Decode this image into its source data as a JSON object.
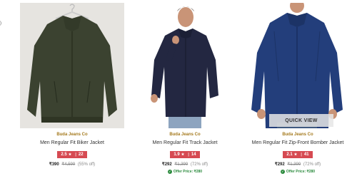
{
  "page": {
    "edge_glyph": ")"
  },
  "products": [
    {
      "brand": "Buda Jeans Co",
      "title": "Men Regular Fit Biker Jacket",
      "rating": "2.5",
      "reviews": "22",
      "price": "₹390",
      "mrp": "₹4,599",
      "discount": "(55% off)",
      "offer": "",
      "jacket_color": "#3b4230",
      "quick_view": ""
    },
    {
      "brand": "Buda Jeans Co",
      "title": "Men Regular Fit Track Jacket",
      "rating": "1.9",
      "reviews": "14",
      "price": "₹292",
      "mrp": "₹1,399",
      "discount": "(72% off)",
      "offer": "Offer Price: ₹280",
      "jacket_color": "#232741",
      "quick_view": ""
    },
    {
      "brand": "Buda Jeans Co",
      "title": "Men Regular Fit Zip-Front Bomber Jacket",
      "rating": "2.1",
      "reviews": "41",
      "price": "₹292",
      "mrp": "₹1,399",
      "discount": "(72% off)",
      "offer": "Offer Price: ₹280",
      "jacket_color": "#233e7b",
      "quick_view": "QUICK VIEW"
    }
  ],
  "colors": {
    "brand_text": "#a57a1e",
    "rating_bg": "#d64a52",
    "offer_green": "#2a8a3c"
  }
}
